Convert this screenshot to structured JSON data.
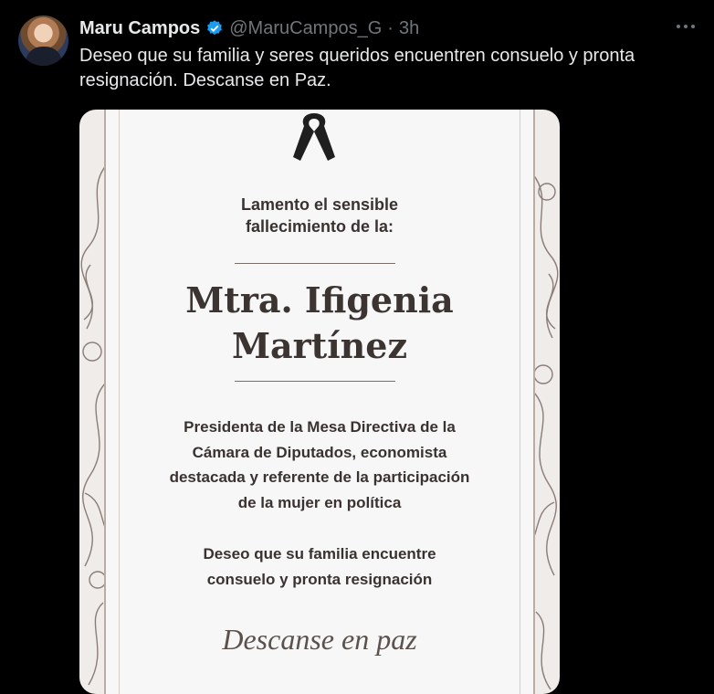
{
  "tweet": {
    "author_name": "Maru Campos",
    "handle": "@MaruCampos_G",
    "separator": "·",
    "time": "3h",
    "text": "Deseo que su familia y seres queridos encuentren consuelo y pronta resignación. Descanse en Paz."
  },
  "card": {
    "lament_line1": "Lamento el sensible",
    "lament_line2": "fallecimiento de la:",
    "honoree_line1": "Mtra. Ifigenia",
    "honoree_line2": "Martínez",
    "role_line1": "Presidenta de la Mesa Directiva de la",
    "role_line2": "Cámara de Diputados, economista",
    "role_line3": "destacada y referente de la participación",
    "role_line4": "de la mujer en política",
    "wish_line1": "Deseo que su familia encuentre",
    "wish_line2": "consuelo y pronta resignación",
    "closing": "Descanse en paz"
  },
  "icons": {
    "verified": "verified-badge-icon",
    "more": "more-options-icon",
    "ribbon": "mourning-ribbon-icon"
  },
  "colors": {
    "background": "#000000",
    "verified": "#1d9bf0",
    "card_text": "#3a3230"
  }
}
